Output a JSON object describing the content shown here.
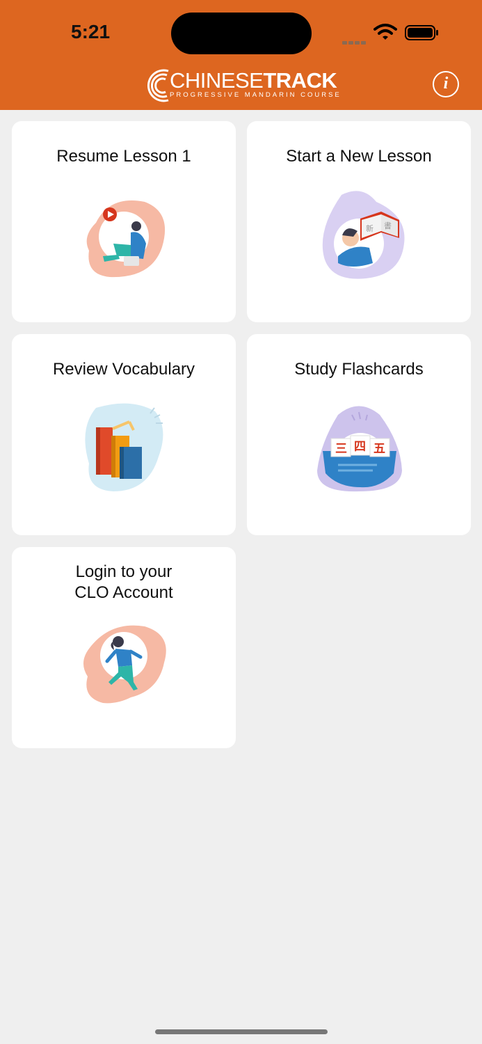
{
  "status_bar": {
    "time": "5:21"
  },
  "header": {
    "logo_light": "CHINESE",
    "logo_bold": "TRACK",
    "logo_subtitle": "PROGRESSIVE MANDARIN COURSE",
    "info_glyph": "i"
  },
  "cards": [
    {
      "title": "Resume Lesson 1",
      "icon": "video-lesson-icon",
      "blob_color": "#f6b9a4"
    },
    {
      "title": "Start a New Lesson",
      "icon": "open-book-icon",
      "blob_color": "#d9d0f2"
    },
    {
      "title": "Review Vocabulary",
      "icon": "books-stack-icon",
      "blob_color": "#d3ebf5"
    },
    {
      "title": "Study Flashcards",
      "icon": "flashcards-icon",
      "blob_color": "#cdc3ec",
      "flashcard_chars": [
        "三",
        "四",
        "五"
      ]
    },
    {
      "title_line1": "Login to your",
      "title_line2": "CLO Account",
      "icon": "person-walking-icon",
      "blob_color": "#f6b9a4"
    }
  ],
  "colors": {
    "header": "#dd6620",
    "background": "#efefef",
    "card": "#ffffff"
  }
}
